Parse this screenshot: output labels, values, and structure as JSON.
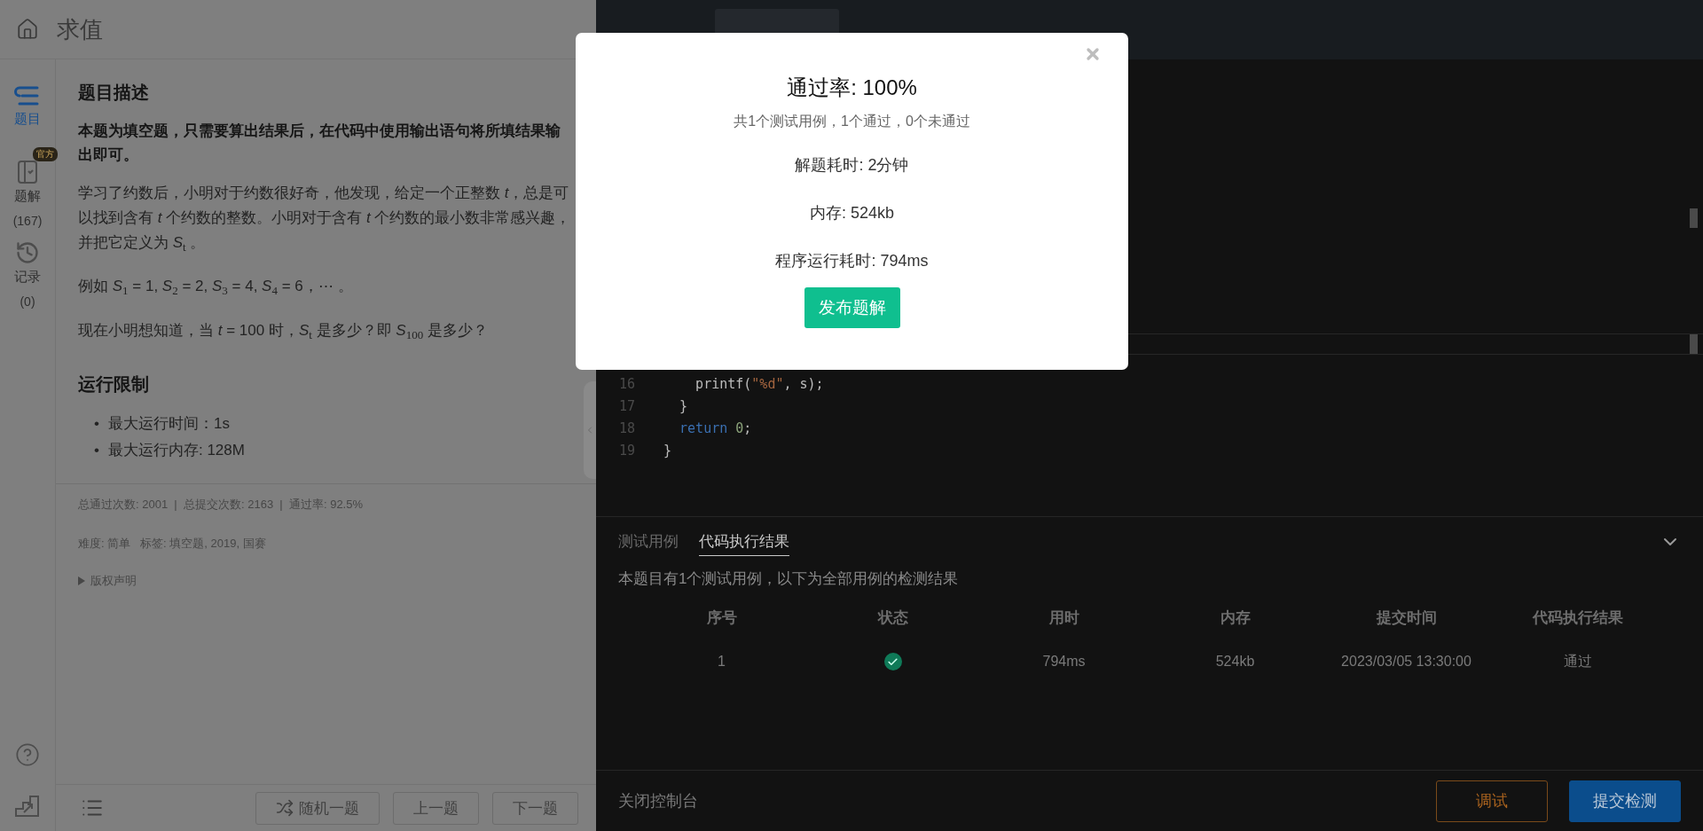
{
  "header": {
    "title": "求值"
  },
  "nav": [
    {
      "kind": "problem",
      "label": "题目",
      "selected": true
    },
    {
      "kind": "solution",
      "label": "题解",
      "badge": "官方",
      "count": "(167)",
      "selected": false
    },
    {
      "kind": "record",
      "label": "记录",
      "count": "(0)",
      "selected": false
    }
  ],
  "nav_bottom": [
    {
      "kind": "help"
    },
    {
      "kind": "stairs"
    }
  ],
  "problem": {
    "heading": "题目描述",
    "notice": "本题为填空题，只需要算出结果后，在代码中使用输出语句将所填结果输出即可。",
    "paragraphs": [
      "学习了约数后，小明对于约数很好奇，他发现，给定一个正整数 *t*，总是可以找到含有 *t* 个约数的整数。小明对于含有 *t* 个约数的最小数非常感兴趣，并把它定义为 *S*$_{t}$ 。",
      "例如 *S*$_{1}$ = 1, *S*$_{2}$ = 2, *S*$_{3}$ = 4, *S*$_{4}$ = 6，⋯ 。",
      "现在小明想知道，当 *t* = 100 时，*S*$_{t}$ 是多少？即 *S*$_{100}$ 是多少？"
    ],
    "limits_heading": "运行限制",
    "limits": [
      {
        "marker": "•",
        "text": "最大运行时间：1s"
      },
      {
        "marker": "•",
        "text": "最大运行内存: 128M"
      }
    ],
    "stats": "总通过次数: 2001  |  总提交次数: 2163  |  通过率: 92.5%",
    "meta": "难度: 简单   标签: 填空题, 2019, 国赛",
    "copyright": {
      "label": "版权声明",
      "expanded": false
    }
  },
  "problem_footer": [
    {
      "kind": "shuffle",
      "label": "随机一题"
    },
    {
      "kind": "plain",
      "label": "上一题"
    },
    {
      "kind": "plain",
      "label": "下一题"
    }
  ],
  "editor": {
    "lines": [
      {
        "number": "16",
        "tokens": [
          {
            "kind": "plain",
            "text": "    printf("
          },
          {
            "kind": "string",
            "text": "\"%d\""
          },
          {
            "kind": "plain",
            "text": ", s);"
          }
        ]
      },
      {
        "number": "17",
        "tokens": [
          {
            "kind": "plain",
            "text": "  }"
          }
        ]
      },
      {
        "number": "18",
        "tokens": [
          {
            "kind": "keyword",
            "text": "  return"
          },
          {
            "kind": "number",
            "text": " 0"
          },
          {
            "kind": "plain",
            "text": ";"
          }
        ]
      },
      {
        "number": "19",
        "tokens": [
          {
            "kind": "plain",
            "text": "}"
          }
        ]
      }
    ]
  },
  "console": {
    "tabs": [
      {
        "label": "测试用例",
        "selected": false
      },
      {
        "label": "代码执行结果",
        "selected": true
      }
    ],
    "summary": "本题目有1个测试用例，以下为全部用例的检测结果",
    "columns": [
      "序号",
      "状态",
      "用时",
      "内存",
      "提交时间",
      "代码执行结果"
    ],
    "rows": [
      {
        "index": "1",
        "passed": true,
        "time": "794ms",
        "memory": "524kb",
        "submitted": "2023/03/05 13:30:00",
        "result": "通过"
      }
    ]
  },
  "console_footer": {
    "close": "关闭控制台",
    "buttons": [
      {
        "kind": "outline",
        "label": "调试"
      },
      {
        "kind": "primary",
        "label": "提交检测"
      }
    ]
  },
  "dialog": {
    "title": "通过率: 100%",
    "subtitle": "共1个测试用例，1个通过，0个未通过",
    "details": [
      "解题耗时: 2分钟",
      "内存: 524kb",
      "程序运行耗时: 794ms"
    ],
    "button": "发布题解"
  }
}
